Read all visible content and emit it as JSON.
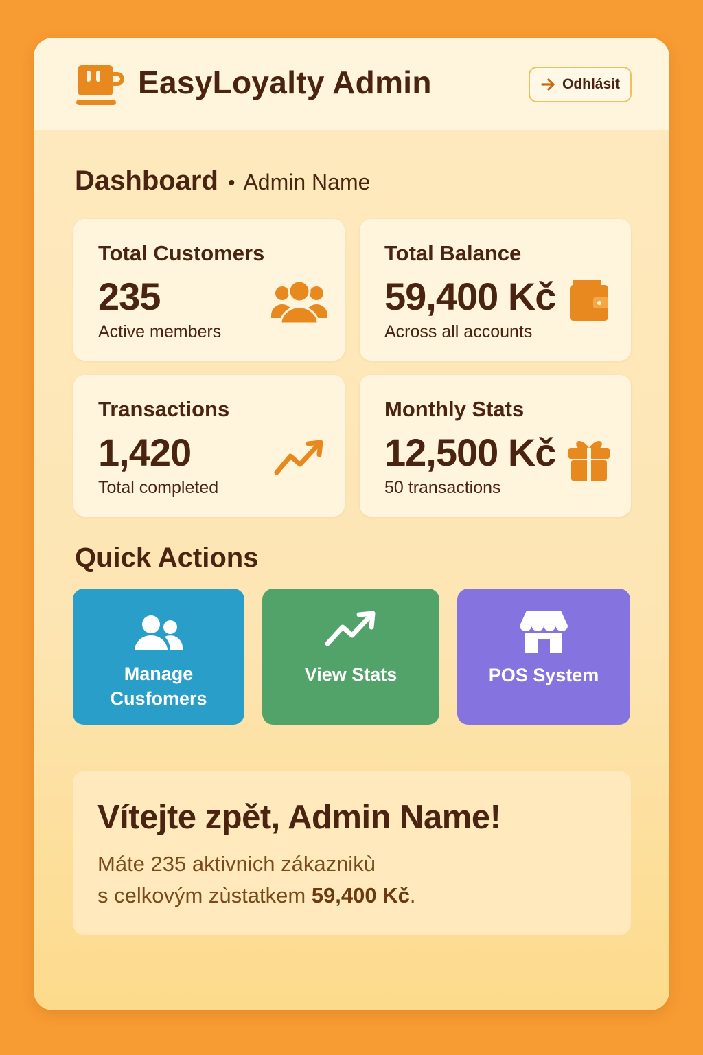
{
  "app": {
    "title": "EasyLoyalty Admin",
    "logo_icon": "coffee-cup-icon"
  },
  "header": {
    "logout_label": "Odhlásit",
    "logout_icon": "arrow-right-icon"
  },
  "dashboard": {
    "title": "Dashboard",
    "separator": "•",
    "user_name": "Admin Name"
  },
  "stats": [
    {
      "label": "Total Customers",
      "value": "235",
      "caption": "Active members",
      "icon": "users-icon"
    },
    {
      "label": "Total Balance",
      "value": "59,400 Kč",
      "caption": "Across all accounts",
      "icon": "wallet-icon"
    },
    {
      "label": "Transactions",
      "value": "1,420",
      "caption": "Total completed",
      "icon": "trend-up-icon"
    },
    {
      "label": "Monthly Stats",
      "value": "12,500 Kč",
      "caption": "50 transactions",
      "icon": "gift-icon"
    }
  ],
  "quick_actions": {
    "title": "Quick Actions",
    "items": [
      {
        "label_line1": "Manage",
        "label_line2": "Cusfomers",
        "icon": "users-icon",
        "color": "#289ec8"
      },
      {
        "label": "View Stats",
        "icon": "trend-up-icon",
        "color": "#52a36a"
      },
      {
        "label": "POS System",
        "icon": "store-icon",
        "color": "#8573e0"
      }
    ]
  },
  "welcome": {
    "title": "Vítejte zpět, Admin Name!",
    "line1": "Máte 235 aktivnich zákaznikù",
    "line2_prefix": "s celkovým zùstatkem ",
    "line2_amount": "59,400 Kč",
    "line2_suffix": "."
  },
  "colors": {
    "background": "#f79b33",
    "accent": "#e8891f",
    "text": "#4a2410"
  }
}
